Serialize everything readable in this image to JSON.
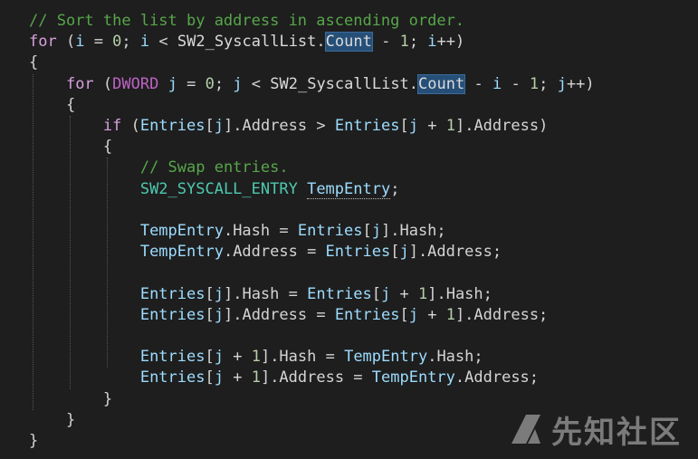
{
  "editor": {
    "theme": {
      "background": "#1e1e1e",
      "comment": "#57a64a",
      "keyword": "#569cd6",
      "control": "#d8a0df",
      "type": "#4ec9b0",
      "local": "#9cdcfe",
      "number": "#b5cea8",
      "plain": "#d4d4d4",
      "highlight": "#264f78"
    },
    "lines": [
      [
        {
          "t": "// Sort the list by address in ascending order.",
          "c": "comment"
        }
      ],
      [
        {
          "t": "for",
          "c": "control"
        },
        {
          "t": " (",
          "c": "plain"
        },
        {
          "t": "i",
          "c": "local"
        },
        {
          "t": " = ",
          "c": "plain"
        },
        {
          "t": "0",
          "c": "number"
        },
        {
          "t": "; ",
          "c": "plain"
        },
        {
          "t": "i",
          "c": "local"
        },
        {
          "t": " < ",
          "c": "plain"
        },
        {
          "t": "SW2_SyscallList",
          "c": "member"
        },
        {
          "t": ".",
          "c": "plain"
        },
        {
          "t": "Count",
          "c": "member",
          "hl": true
        },
        {
          "t": " - ",
          "c": "plain"
        },
        {
          "t": "1",
          "c": "number"
        },
        {
          "t": "; ",
          "c": "plain"
        },
        {
          "t": "i",
          "c": "local"
        },
        {
          "t": "++)",
          "c": "plain"
        }
      ],
      [
        {
          "t": "{",
          "c": "plain"
        }
      ],
      [
        {
          "t": "    ",
          "c": "plain"
        },
        {
          "t": "for",
          "c": "control"
        },
        {
          "t": " (",
          "c": "plain"
        },
        {
          "t": "DWORD",
          "c": "macro"
        },
        {
          "t": " ",
          "c": "plain"
        },
        {
          "t": "j",
          "c": "local"
        },
        {
          "t": " = ",
          "c": "plain"
        },
        {
          "t": "0",
          "c": "number"
        },
        {
          "t": "; ",
          "c": "plain"
        },
        {
          "t": "j",
          "c": "local"
        },
        {
          "t": " < ",
          "c": "plain"
        },
        {
          "t": "SW2_SyscallList",
          "c": "member"
        },
        {
          "t": ".",
          "c": "plain"
        },
        {
          "t": "Count",
          "c": "member",
          "hl": true
        },
        {
          "t": " - ",
          "c": "plain"
        },
        {
          "t": "i",
          "c": "local"
        },
        {
          "t": " - ",
          "c": "plain"
        },
        {
          "t": "1",
          "c": "number"
        },
        {
          "t": "; ",
          "c": "plain"
        },
        {
          "t": "j",
          "c": "local"
        },
        {
          "t": "++)",
          "c": "plain"
        }
      ],
      [
        {
          "t": "    {",
          "c": "plain"
        }
      ],
      [
        {
          "t": "        ",
          "c": "plain"
        },
        {
          "t": "if",
          "c": "control"
        },
        {
          "t": " (",
          "c": "plain"
        },
        {
          "t": "Entries",
          "c": "local"
        },
        {
          "t": "[",
          "c": "plain"
        },
        {
          "t": "j",
          "c": "local"
        },
        {
          "t": "].Address > ",
          "c": "plain"
        },
        {
          "t": "Entries",
          "c": "local"
        },
        {
          "t": "[",
          "c": "plain"
        },
        {
          "t": "j",
          "c": "local"
        },
        {
          "t": " + ",
          "c": "plain"
        },
        {
          "t": "1",
          "c": "number"
        },
        {
          "t": "].Address)",
          "c": "plain"
        }
      ],
      [
        {
          "t": "        {",
          "c": "plain"
        }
      ],
      [
        {
          "t": "            ",
          "c": "plain"
        },
        {
          "t": "// Swap entries.",
          "c": "comment"
        }
      ],
      [
        {
          "t": "            ",
          "c": "plain"
        },
        {
          "t": "SW2_SYSCALL_ENTRY",
          "c": "type"
        },
        {
          "t": " ",
          "c": "plain"
        },
        {
          "t": "TempEntry",
          "c": "local",
          "sq": true
        },
        {
          "t": ";",
          "c": "plain"
        }
      ],
      [],
      [
        {
          "t": "            ",
          "c": "plain"
        },
        {
          "t": "TempEntry",
          "c": "local"
        },
        {
          "t": ".Hash = ",
          "c": "plain"
        },
        {
          "t": "Entries",
          "c": "local"
        },
        {
          "t": "[",
          "c": "plain"
        },
        {
          "t": "j",
          "c": "local"
        },
        {
          "t": "].Hash;",
          "c": "plain"
        }
      ],
      [
        {
          "t": "            ",
          "c": "plain"
        },
        {
          "t": "TempEntry",
          "c": "local"
        },
        {
          "t": ".Address = ",
          "c": "plain"
        },
        {
          "t": "Entries",
          "c": "local"
        },
        {
          "t": "[",
          "c": "plain"
        },
        {
          "t": "j",
          "c": "local"
        },
        {
          "t": "].Address;",
          "c": "plain"
        }
      ],
      [],
      [
        {
          "t": "            ",
          "c": "plain"
        },
        {
          "t": "Entries",
          "c": "local"
        },
        {
          "t": "[",
          "c": "plain"
        },
        {
          "t": "j",
          "c": "local"
        },
        {
          "t": "].Hash = ",
          "c": "plain"
        },
        {
          "t": "Entries",
          "c": "local"
        },
        {
          "t": "[",
          "c": "plain"
        },
        {
          "t": "j",
          "c": "local"
        },
        {
          "t": " + ",
          "c": "plain"
        },
        {
          "t": "1",
          "c": "number"
        },
        {
          "t": "].Hash;",
          "c": "plain"
        }
      ],
      [
        {
          "t": "            ",
          "c": "plain"
        },
        {
          "t": "Entries",
          "c": "local"
        },
        {
          "t": "[",
          "c": "plain"
        },
        {
          "t": "j",
          "c": "local"
        },
        {
          "t": "].Address = ",
          "c": "plain"
        },
        {
          "t": "Entries",
          "c": "local"
        },
        {
          "t": "[",
          "c": "plain"
        },
        {
          "t": "j",
          "c": "local"
        },
        {
          "t": " + ",
          "c": "plain"
        },
        {
          "t": "1",
          "c": "number"
        },
        {
          "t": "].Address;",
          "c": "plain"
        }
      ],
      [],
      [
        {
          "t": "            ",
          "c": "plain"
        },
        {
          "t": "Entries",
          "c": "local"
        },
        {
          "t": "[",
          "c": "plain"
        },
        {
          "t": "j",
          "c": "local"
        },
        {
          "t": " + ",
          "c": "plain"
        },
        {
          "t": "1",
          "c": "number"
        },
        {
          "t": "].Hash = ",
          "c": "plain"
        },
        {
          "t": "TempEntry",
          "c": "local"
        },
        {
          "t": ".Hash;",
          "c": "plain"
        }
      ],
      [
        {
          "t": "            ",
          "c": "plain"
        },
        {
          "t": "Entries",
          "c": "local"
        },
        {
          "t": "[",
          "c": "plain"
        },
        {
          "t": "j",
          "c": "local"
        },
        {
          "t": " + ",
          "c": "plain"
        },
        {
          "t": "1",
          "c": "number"
        },
        {
          "t": "].Address = ",
          "c": "plain"
        },
        {
          "t": "TempEntry",
          "c": "local"
        },
        {
          "t": ".Address;",
          "c": "plain"
        }
      ],
      [
        {
          "t": "        }",
          "c": "plain"
        }
      ],
      [
        {
          "t": "    }",
          "c": "plain"
        }
      ],
      [
        {
          "t": "}",
          "c": "plain"
        }
      ]
    ]
  },
  "watermark": {
    "text": "先知社区",
    "icon": "xianzhi-logo-icon"
  }
}
